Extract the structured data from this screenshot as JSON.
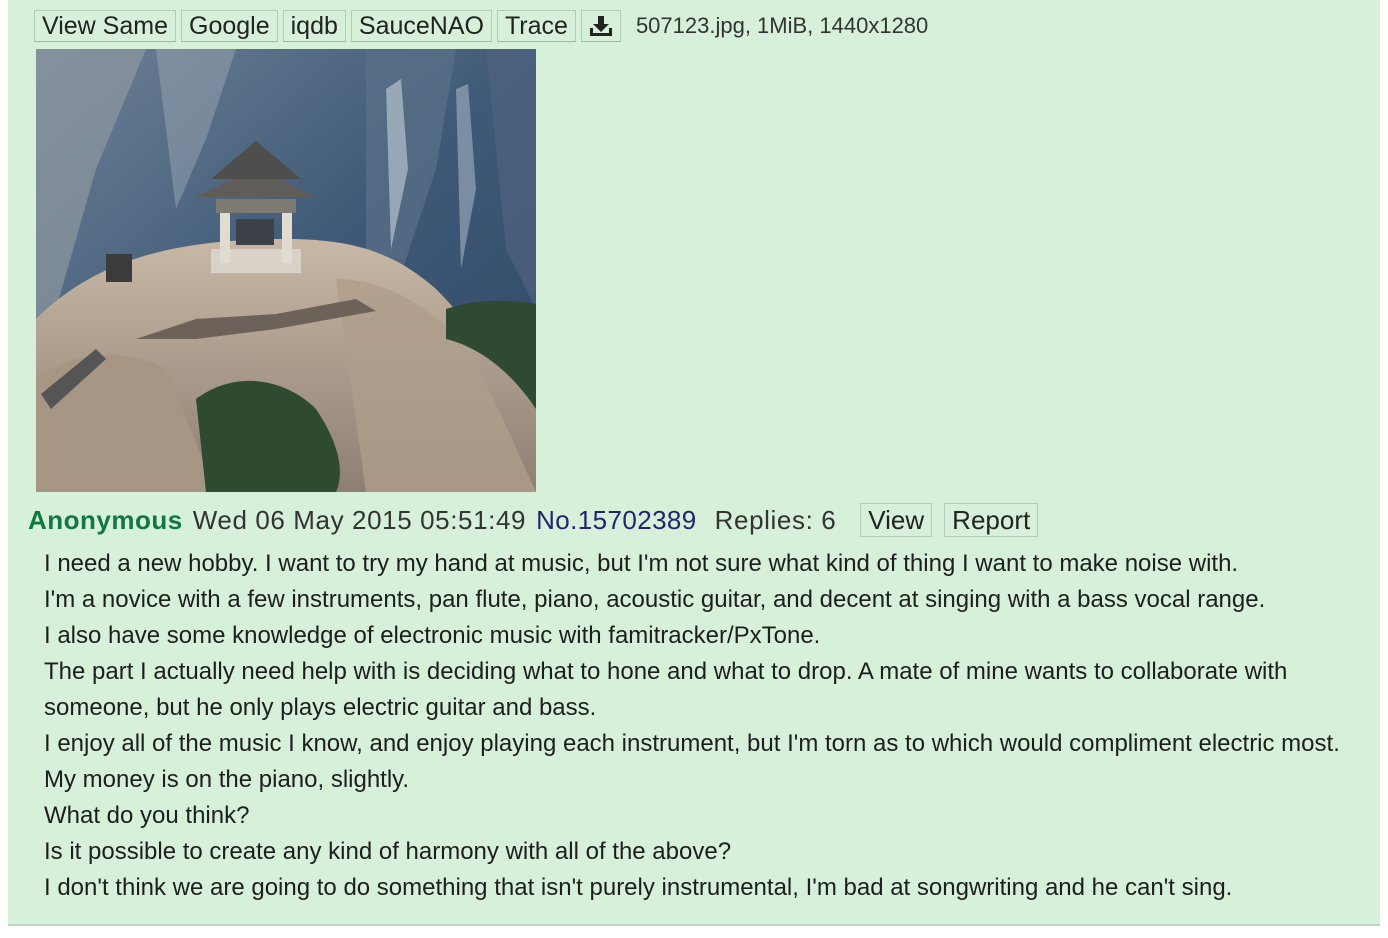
{
  "toolbar": {
    "buttons": [
      "View Same",
      "Google",
      "iqdb",
      "SauceNAO",
      "Trace"
    ],
    "download_icon": "download-icon",
    "file_info": "507123.jpg, 1MiB, 1440x1280"
  },
  "post": {
    "name": "Anonymous",
    "date": "Wed 06 May 2015 05:51:49",
    "number": "No.15702389",
    "replies": "Replies: 6",
    "view_label": "View",
    "report_label": "Report",
    "comment_lines": [
      "I need a new hobby. I want to try my hand at music, but I'm not sure what kind of thing I want to make noise with.",
      "I'm a novice with a few instruments, pan flute, piano, acoustic guitar, and decent at singing with a bass vocal range.",
      "I also have some knowledge of electronic music with famitracker/PxTone.",
      "The part I actually need help with is deciding what to hone and what to drop. A mate of mine wants to collaborate with someone, but he only plays electric guitar and bass.",
      "I enjoy all of the music I know, and enjoy playing each instrument, but I'm torn as to which would compliment electric most. My money is on the piano, slightly.",
      "What do you think?",
      "Is it possible to create any kind of harmony with all of the above?",
      "I don't think we are going to do something that isn't purely instrumental, I'm bad at songwriting and he can't sing."
    ]
  },
  "colors": {
    "post_bg": "#d6f0da",
    "name": "#117743",
    "post_number": "#24246e"
  }
}
